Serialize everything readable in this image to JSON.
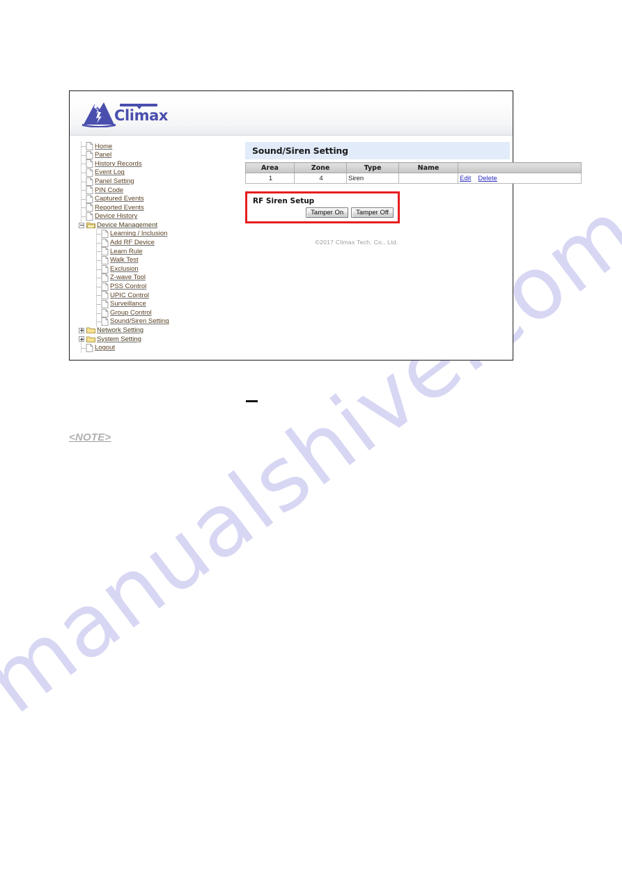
{
  "watermark": {
    "text": "manualshive.com"
  },
  "brand": {
    "name": "Climax",
    "logo_icon": "climax-mountain-logo",
    "accent_color": "#4a4fae"
  },
  "sidebar": {
    "items": [
      {
        "label": "Home",
        "icon": "page-icon",
        "level": 1,
        "expander": "none"
      },
      {
        "label": "Panel",
        "icon": "page-icon",
        "level": 1,
        "expander": "none"
      },
      {
        "label": "History Records",
        "icon": "page-icon",
        "level": 1,
        "expander": "none"
      },
      {
        "label": "Event Log",
        "icon": "page-icon",
        "level": 1,
        "expander": "none"
      },
      {
        "label": "Panel Setting",
        "icon": "page-icon",
        "level": 1,
        "expander": "none"
      },
      {
        "label": "PIN Code",
        "icon": "page-icon",
        "level": 1,
        "expander": "none"
      },
      {
        "label": "Captured Events",
        "icon": "page-icon",
        "level": 1,
        "expander": "none"
      },
      {
        "label": "Reported Events",
        "icon": "page-icon",
        "level": 1,
        "expander": "none"
      },
      {
        "label": "Device History",
        "icon": "page-icon",
        "level": 1,
        "expander": "none"
      },
      {
        "label": "Device Management",
        "icon": "folder-open-icon",
        "level": 1,
        "expander": "minus"
      },
      {
        "label": "Learning / Inclusion",
        "icon": "page-icon",
        "level": 2,
        "expander": "none"
      },
      {
        "label": "Add RF Device",
        "icon": "page-icon",
        "level": 2,
        "expander": "none"
      },
      {
        "label": "Learn Rule",
        "icon": "page-icon",
        "level": 2,
        "expander": "none"
      },
      {
        "label": "Walk Test",
        "icon": "page-icon",
        "level": 2,
        "expander": "none"
      },
      {
        "label": "Exclusion",
        "icon": "page-icon",
        "level": 2,
        "expander": "none"
      },
      {
        "label": "Z-wave Tool",
        "icon": "page-icon",
        "level": 2,
        "expander": "none"
      },
      {
        "label": "PSS Control",
        "icon": "page-icon",
        "level": 2,
        "expander": "none"
      },
      {
        "label": "UPIC Control",
        "icon": "page-icon",
        "level": 2,
        "expander": "none"
      },
      {
        "label": "Surveillance",
        "icon": "page-icon",
        "level": 2,
        "expander": "none"
      },
      {
        "label": "Group Control",
        "icon": "page-icon",
        "level": 2,
        "expander": "none"
      },
      {
        "label": "Sound/Siren Setting",
        "icon": "page-icon",
        "level": 2,
        "expander": "none"
      },
      {
        "label": "Network Setting",
        "icon": "folder-closed-icon",
        "level": 1,
        "expander": "plus"
      },
      {
        "label": "System Setting",
        "icon": "folder-closed-icon",
        "level": 1,
        "expander": "plus"
      },
      {
        "label": "Logout",
        "icon": "page-icon",
        "level": 1,
        "expander": "none"
      }
    ]
  },
  "main": {
    "title": "Sound/Siren Setting",
    "table": {
      "headers": [
        "Area",
        "Zone",
        "Type",
        "Name",
        ""
      ],
      "rows": [
        {
          "area": "1",
          "zone": "4",
          "type": "Siren",
          "name": "",
          "edit": "Edit",
          "delete": "Delete"
        }
      ]
    },
    "rf_siren": {
      "title": "RF Siren Setup",
      "tamper_on": "Tamper On",
      "tamper_off": "Tamper Off",
      "highlight_color": "#e71d1d"
    },
    "copyright": "©2017 Climax Tech. Co., Ltd."
  },
  "document": {
    "note_label": "<NOTE>"
  }
}
